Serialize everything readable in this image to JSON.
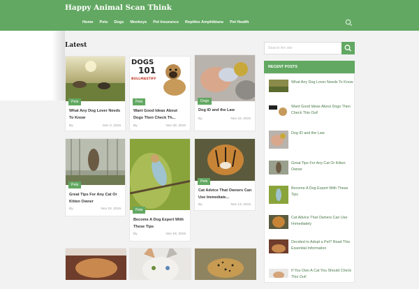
{
  "site": {
    "title": "Happy Animal Scan Think"
  },
  "nav": {
    "items": [
      "Home",
      "Pets",
      "Dogs",
      "Monkeys",
      "Pet Insurance",
      "Reptiles Amphibians",
      "Pet Health"
    ]
  },
  "section_title": "Latest",
  "posts": [
    {
      "tag": "Pets",
      "title": "What Any Dog Lover Needs To Know",
      "by": "By",
      "date": "Dec 3, 2015"
    },
    {
      "tag": "Pets",
      "title": "Want Good Ideas About Dogs Then Check Th...",
      "by": "By",
      "date": "Nov 28, 2015"
    },
    {
      "tag": "Dogs",
      "title": "Dog ID and the Law",
      "by": "By",
      "date": "Nov 23, 2015"
    },
    {
      "tag": "Pets",
      "title": "Great Tips For Any Cat Or Kitten Owner",
      "by": "By",
      "date": "Nov 23, 2015"
    },
    {
      "tag": "Pets",
      "title": "Become A Dog Expert With These Tips",
      "by": "By",
      "date": "Nov 18, 2015"
    },
    {
      "tag": "Pets",
      "title": "Cat Advice That Owners Can Use Immediate...",
      "by": "By",
      "date": "Nov 13, 2015"
    }
  ],
  "dog_logo": {
    "line1": "DOGS",
    "line2": "101",
    "line3": "BULLMASTIFF"
  },
  "sidebar": {
    "search_placeholder": "Search the site",
    "recent_title": "RECENT POSTS",
    "recent": [
      "What Any Dog Lover Needs To Know",
      "Want Good Ideas About Dogs Then Check This Out!",
      "Dog ID and the Law",
      "Great Tips For Any Cat Or Kitten Owner",
      "Become A Dog Expert With These Tips",
      "Cat Advice That Owners Can Use Immediately",
      "Decided to Adopt a Pet? Read This Essential Information",
      "If You Own A Cat You Should Check This Out!"
    ]
  },
  "colors": {
    "accent": "#62a862"
  },
  "icons": {
    "search": "search-icon"
  }
}
